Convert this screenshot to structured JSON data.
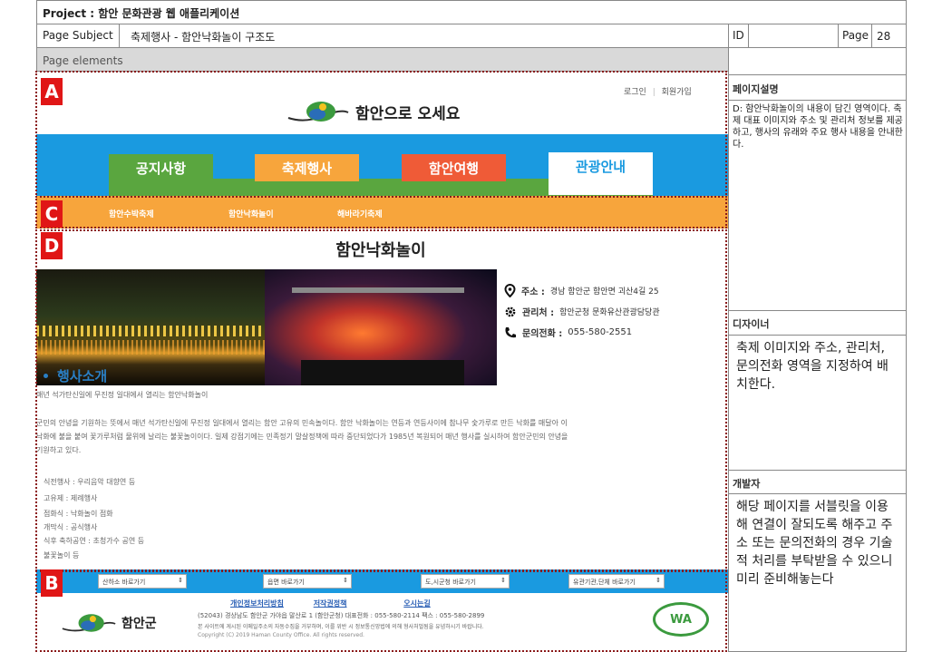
{
  "header": {
    "project_label": "Project : 함안 문화관광 웹 애플리케이션",
    "page_subject_label": "Page Subject",
    "page_subject_value": "축제행사 - 함안낙화놀이 구조도",
    "id_label": "ID",
    "id_value": "",
    "page_label": "Page",
    "page_value": "28",
    "page_elements_label": "Page elements"
  },
  "markers": {
    "a": "A",
    "b": "B",
    "c": "C",
    "d": "D"
  },
  "site": {
    "login": "로그인",
    "separator": "|",
    "join": "회원가입",
    "logo_text": "함안으로 오세요",
    "nav": [
      {
        "label": "공지사항",
        "color": "#5aa63f"
      },
      {
        "label": "축제행사",
        "color": "#f7a53c"
      },
      {
        "label": "함안여행",
        "color": "#ef5b37"
      },
      {
        "label": "관광안내",
        "color": "#ffffff"
      }
    ],
    "subnav": [
      "함안수박축제",
      "함안낙화놀이",
      "해바라기축제"
    ],
    "page_title": "함안낙화놀이",
    "info": {
      "address_label": "주소 :",
      "address_value": "경남 함안군 함안면 괴산4길 25",
      "manager_label": "관리처 :",
      "manager_value": "함안군청 문화유산관광담당관",
      "phone_label": "문의전화 :",
      "phone_value": "055-580-2551"
    },
    "intro_title": "행사소개",
    "intro_lead": "매년 석가탄신일에 무진정 일대에서 열리는 함안낙화놀이",
    "intro_body_1": "군민의 안녕을 기원하는 뜻에서 매년 석가탄신일에 무진정 일대에서 열리는 함안 고유의 민속놀이다. 함안 낙화놀이는 연등과 연등사이에 참나무 숯가루로 만든 낙화를 매달아 이",
    "intro_body_2": "낙화에 불을 붙여 꽃가루처럼 물위에 날리는 불꽃놀이이다. 일제 강점기에는 민족정기 말살정책에 따라 중단되었다가 1985년 복원되어 매년 행사를 실시하여 함안군민의 안녕을",
    "intro_body_3": "기원하고 있다.",
    "program": [
      "식전행사 : 우리음악 대향연 등",
      "고유제 : 제례행사",
      "점화식 : 낙화놀이 점화",
      "개막식 : 공식행사",
      "식후 축하공연 : 초청가수 공연 등",
      "불꽃놀이 등"
    ],
    "footer_selects": [
      "산하소 바로가기",
      "읍면 바로가기",
      "도,시군청 바로가기",
      "유관기관,단체 바로가기"
    ],
    "footer_links": [
      "개인정보처리방침",
      "저작권정책",
      "오시는길"
    ],
    "footer_address": "(52043) 경상남도 함안군 가야읍 말산로 1 (함안군청)    대표전화 : 055-580-2114    팩스 : 055-580-2899",
    "footer_notice": "본 사이트에 게시된 이메일주소의 자동수집을 거부하며, 이를 위반 시 정보통신망법에 의해 형사처벌됨을 유념하시기 바랍니다.",
    "footer_copyright": "Copyright (C) 2019 Haman County Office. All rights reserved.",
    "footer_logo_text": "함안군",
    "wa_badge": "WA"
  },
  "sidebar": {
    "desc_title": "페이지설명",
    "desc_text": "D: 함안낙화놀이의 내용이 담긴 영역이다. 축제 대표 이미지와 주소 및 관리처 정보를 제공하고, 행사의 유래와 주요 행사 내용을 안내한다.",
    "designer_title": "디자이너",
    "designer_text": "축제 이미지와 주소, 관리처, 문의전화 영역을 지정하여 배치한다.",
    "developer_title": "개발자",
    "developer_text": "해당 페이지를 서블릿을 이용해 연결이 잘되도록 해주고 주소 또는 문의전화의 경우 기술적 처리를 부탁받을 수 있으니 미리 준비해놓는다"
  },
  "colors": {
    "nav_bar": "#1a9ae0",
    "subnav_bar": "#f7a53c",
    "marker": "#e01616",
    "intro_title": "#2a7fc4"
  }
}
